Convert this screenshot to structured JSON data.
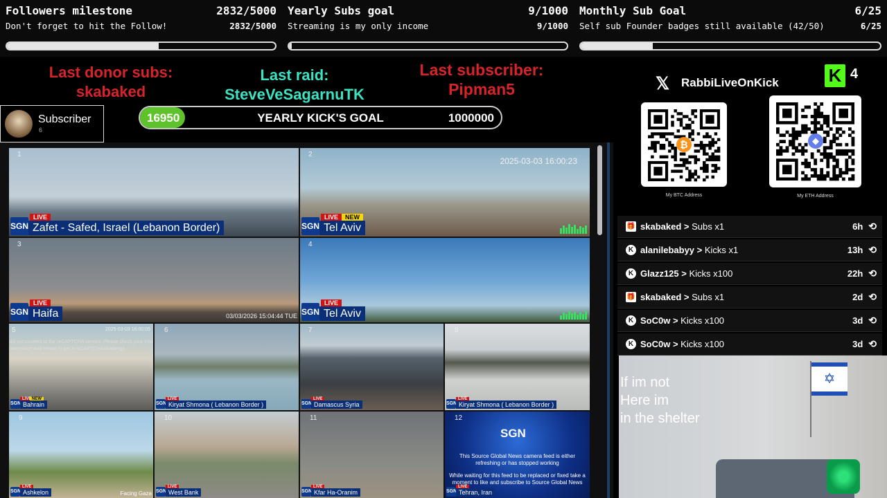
{
  "goals": [
    {
      "title": "Followers milestone",
      "count": "2832/5000",
      "sub": "Don't forget to hit the Follow!",
      "count2": "2832/5000",
      "fill": 0.566
    },
    {
      "title": "Yearly Subs goal",
      "count": "9/1000",
      "sub": "Streaming is my only income",
      "count2": "9/1000",
      "fill": 0.009
    },
    {
      "title": "Monthly Sub Goal",
      "count": "6/25",
      "sub": "Self sub Founder badges still available (42/50)",
      "count2": "6/25",
      "fill": 0.24
    }
  ],
  "donor": {
    "label": "Last donor subs:",
    "name": "skabaked",
    "color": "#d8232a"
  },
  "raid": {
    "label": "Last raid:",
    "name": "SteveVeSagarnuTK",
    "color": "#3be3c3"
  },
  "lastsub": {
    "label": "Last subscriber:",
    "name": "Pipman5",
    "color": "#d8232a"
  },
  "subscriber_widget": {
    "label": "Subscriber",
    "count": "6"
  },
  "kick_goal": {
    "current": "16950",
    "title": "YEARLY KICK'S GOAL",
    "target": "1000000",
    "fill": 0.017
  },
  "social": {
    "handle": "RabbiLiveOnKick",
    "kick_count": "4"
  },
  "qr": [
    {
      "caption": "My BTC Address",
      "coin": "₿",
      "coin_color": "#f7931a"
    },
    {
      "caption": "My ETH Address",
      "coin": "◆",
      "coin_color": "#627eea"
    }
  ],
  "cams": [
    {
      "num": "1",
      "location": "Zafet - Safed, Israel (Lebanon Border)",
      "live": "LIVE"
    },
    {
      "num": "2",
      "location": "Tel Aviv",
      "live": "LIVE",
      "new": "NEW",
      "timestamp": "2025-03-03 16:00:23"
    },
    {
      "num": "3",
      "location": "Haifa",
      "live": "LIVE",
      "timestamp": "03/03/2026 15:04:44 TUE"
    },
    {
      "num": "4",
      "location": "Tel Aviv",
      "live": "LIVE"
    },
    {
      "num": "5",
      "location": "Bahrain",
      "live": "LIVE",
      "new": "NEW",
      "error": "did not connect to the reCAPTCHA service. Please check your internet connection and reload to get a reCAPTCHA challenge.",
      "timestamp": "2025-03-03 16:00:05"
    },
    {
      "num": "6",
      "location": "Kiryat Shmona ( Lebanon Border )",
      "live": "LIVE"
    },
    {
      "num": "7",
      "location": "Damascus Syria",
      "live": "LIVE"
    },
    {
      "num": "8",
      "location": "Kiryat Shmona ( Lebanon Border )",
      "live": "LIVE"
    },
    {
      "num": "9",
      "location": "Ashkelon",
      "live": "LIVE",
      "overlay": "Facing Gaza"
    },
    {
      "num": "10",
      "location": "West Bank",
      "live": "LIVE"
    },
    {
      "num": "11",
      "location": "Kfar Ha-Oranim",
      "live": "LIVE"
    },
    {
      "num": "12",
      "location": "Tehran, Iran",
      "live": "LIVE"
    }
  ],
  "sgn_card": {
    "brand": "SGN",
    "line1": "This Source Global News camera feed is either refreshing or has stopped working",
    "line2": "While waiting for this feed to be replaced or fixed take a moment to like and subscribe to Source Global News"
  },
  "sgn_logo": "SGN",
  "events": [
    {
      "icon": "gift",
      "user": "skabaked",
      "action": "Subs x1",
      "time": "6h"
    },
    {
      "icon": "kick",
      "user": "alanilebabyy",
      "action": "Kicks x1",
      "time": "13h"
    },
    {
      "icon": "kick",
      "user": "Glazz125",
      "action": "Kicks x100",
      "time": "22h"
    },
    {
      "icon": "gift",
      "user": "skabaked",
      "action": "Subs x1",
      "time": "2d"
    },
    {
      "icon": "kick",
      "user": "SoC0w",
      "action": "Kicks x100",
      "time": "3d"
    },
    {
      "icon": "kick",
      "user": "SoC0w",
      "action": "Kicks x100",
      "time": "3d"
    }
  ],
  "webcam_note": {
    "line1": "If im not",
    "line2": "Here im",
    "line3": "in the shelter"
  }
}
